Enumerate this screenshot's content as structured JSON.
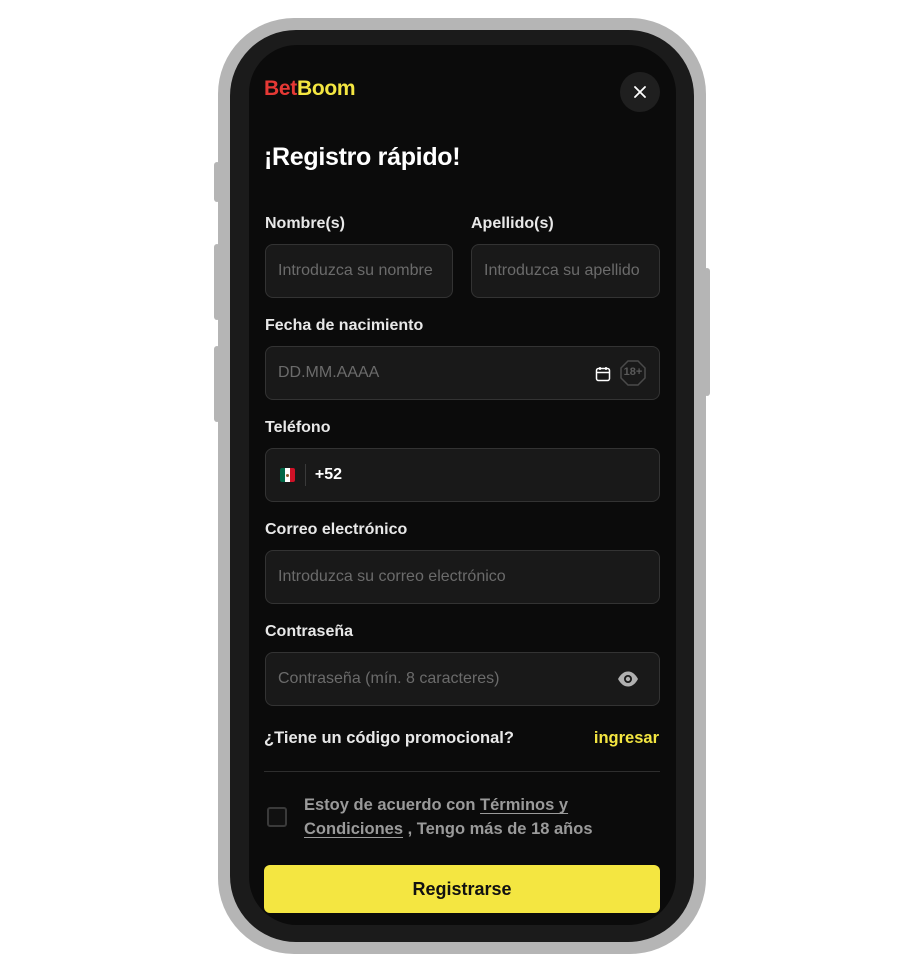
{
  "brand": {
    "part1": "Bet",
    "part2": "Boom",
    "color1": "#e53935",
    "color2": "#f4e641"
  },
  "form": {
    "title": "¡Registro rápido!",
    "nombre": {
      "label": "Nombre(s)",
      "placeholder": "Introduzca su nombre"
    },
    "apellido": {
      "label": "Apellido(s)",
      "placeholder": "Introduzca su apellido"
    },
    "fecha": {
      "label": "Fecha de nacimiento",
      "placeholder": "DD.MM.AAAA",
      "age_badge": "18+"
    },
    "telefono": {
      "label": "Teléfono",
      "prefix": "+52",
      "country_icon": "mexico-flag-icon"
    },
    "correo": {
      "label": "Correo electrónico",
      "placeholder": "Introduzca su correo electrónico"
    },
    "contrasena": {
      "label": "Contraseña",
      "placeholder": "Contraseña (mín. 8 caracteres)"
    },
    "promo": {
      "question": "¿Tiene un código promocional?",
      "link": "ingresar"
    },
    "terms": {
      "prefix": "Estoy de acuerdo con ",
      "link": "Términos y Condiciones",
      "suffix": " , Tengo más de 18 años"
    },
    "submit_label": "Registrarse"
  },
  "colors": {
    "accent": "#f4e641",
    "background": "#0b0b0b",
    "field": "#191919"
  }
}
